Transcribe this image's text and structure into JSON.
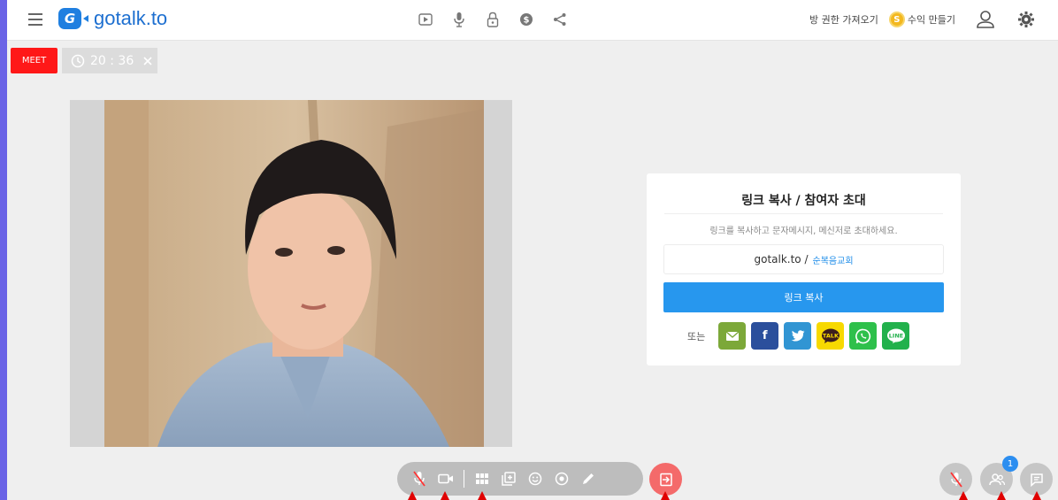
{
  "header": {
    "logo_letter": "G",
    "logo_text": "gotalk.to",
    "right_links": {
      "get_permission": "방 권한 가져오기",
      "coin_symbol": "S",
      "make_revenue": "수익 만들기"
    },
    "center_icons": [
      "play-icon",
      "microphone-icon",
      "lock-icon",
      "dollar-icon",
      "share-icon"
    ],
    "right_icons": [
      "user-icon",
      "gear-icon"
    ]
  },
  "meeting": {
    "tag": "MEET",
    "timer": "20 : 36"
  },
  "invite": {
    "title": "링크 복사 / 참여자 초대",
    "description": "링크를 복사하고 문자메시지, 메신저로 초대하세요.",
    "link_domain": "gotalk.to /",
    "link_room": "순복음교회",
    "copy_label": "링크 복사",
    "or_label": "또는",
    "share_buttons": [
      {
        "name": "email",
        "color": "#7ca839"
      },
      {
        "name": "facebook",
        "label": "f",
        "color": "#2b4f9c"
      },
      {
        "name": "twitter",
        "color": "#3195d3"
      },
      {
        "name": "kakaotalk",
        "label": "TALK",
        "color": "#f7d900"
      },
      {
        "name": "whatsapp",
        "color": "#2ec04b"
      },
      {
        "name": "line",
        "label": "LINE",
        "color": "#22b14c"
      }
    ]
  },
  "controls": {
    "toolbar_icons": [
      "mic-off-icon",
      "camera-icon",
      "grid-icon",
      "add-screen-icon",
      "emoji-icon",
      "record-icon",
      "pen-icon"
    ],
    "exit_icon": "exit-icon",
    "right_icons": [
      "mic-off-icon",
      "participants-icon",
      "chat-icon"
    ],
    "participant_count": "1"
  },
  "colors": {
    "accent": "#2797ee",
    "meet_red": "#ff1818",
    "exit_red": "#f46a6a"
  }
}
